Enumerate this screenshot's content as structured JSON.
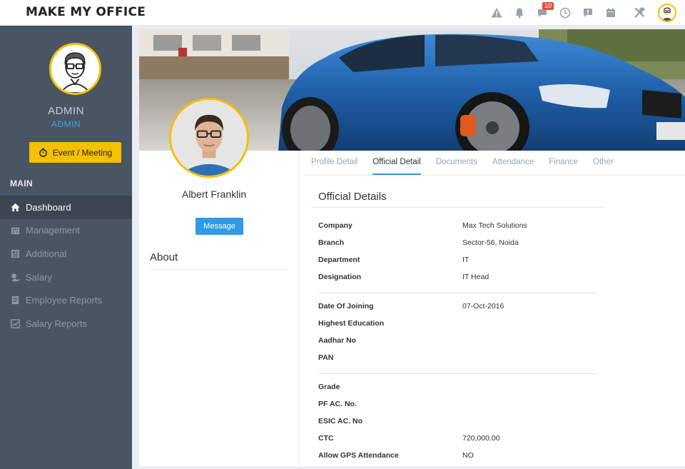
{
  "app": {
    "brand": "MAKE MY OFFICE"
  },
  "topbar": {
    "chat_badge": "10"
  },
  "sidebar": {
    "user_name": "ADMIN",
    "user_role": "ADMIN",
    "event_button": "Event / Meeting",
    "section_label": "MAIN",
    "items": [
      {
        "label": "Dashboard",
        "icon": "home-icon",
        "active": true
      },
      {
        "label": "Management",
        "icon": "building-icon"
      },
      {
        "label": "Additional",
        "icon": "grid-icon"
      },
      {
        "label": "Salary",
        "icon": "money-icon"
      },
      {
        "label": "Employee Reports",
        "icon": "report-icon"
      },
      {
        "label": "Salary Reports",
        "icon": "chart-icon"
      }
    ]
  },
  "profile": {
    "name": "Albert Franklin",
    "message_button": "Message",
    "about_label": "About"
  },
  "tabs": [
    "Profile Detail",
    "Official Detail",
    "Documents",
    "Attendance",
    "Finance",
    "Other"
  ],
  "details": {
    "title": "Official Details",
    "group1": [
      {
        "label": "Company",
        "value": "Max Tech Solutions"
      },
      {
        "label": "Branch",
        "value": "Sector-56, Noida"
      },
      {
        "label": "Department",
        "value": "IT"
      },
      {
        "label": "Designation",
        "value": "IT Head"
      }
    ],
    "group2": [
      {
        "label": "Date Of Joining",
        "value": "07-Oct-2016"
      },
      {
        "label": "Highest Education",
        "value": ""
      },
      {
        "label": "Aadhar No",
        "value": ""
      },
      {
        "label": "PAN",
        "value": ""
      }
    ],
    "group3": [
      {
        "label": "Grade",
        "value": ""
      },
      {
        "label": "PF AC. No.",
        "value": ""
      },
      {
        "label": "ESIC AC. No",
        "value": ""
      },
      {
        "label": "CTC",
        "value": "720,000.00"
      },
      {
        "label": "Allow GPS Attendance",
        "value": "NO"
      }
    ]
  },
  "colors": {
    "accent": "#f5c000",
    "primary": "#2f9be6",
    "sidebar": "#4a5563"
  }
}
